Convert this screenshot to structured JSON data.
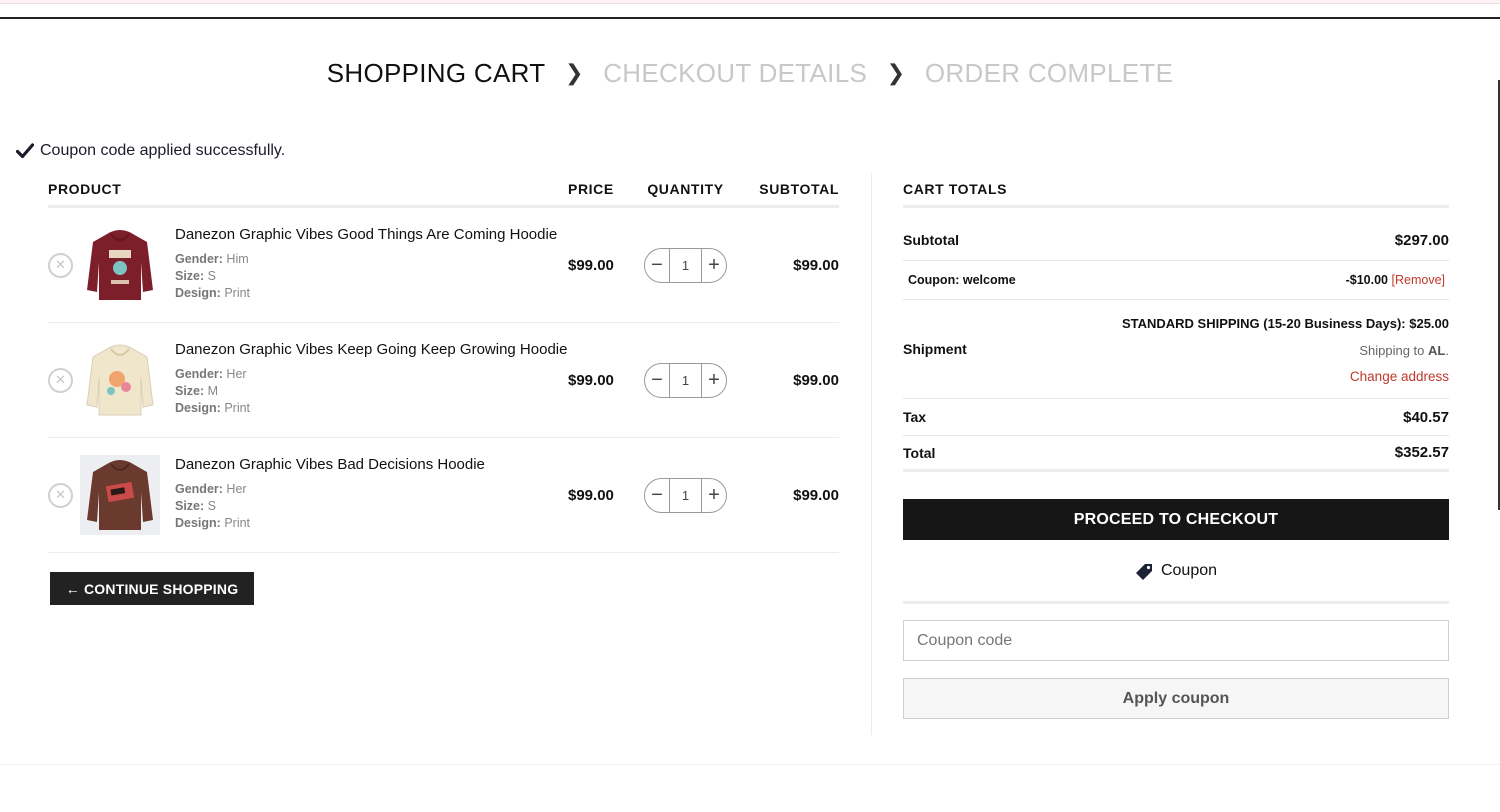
{
  "steps": {
    "cart": "SHOPPING CART",
    "checkout": "CHECKOUT DETAILS",
    "complete": "ORDER COMPLETE"
  },
  "notice": "Coupon code applied successfully.",
  "cart": {
    "headers": {
      "product": "PRODUCT",
      "price": "PRICE",
      "quantity": "QUANTITY",
      "subtotal": "SUBTOTAL"
    },
    "items": [
      {
        "name": "Danezon Graphic Vibes Good Things Are Coming Hoodie",
        "gender_label": "Gender:",
        "gender": "Him",
        "size_label": "Size:",
        "size": "S",
        "design_label": "Design:",
        "design": "Print",
        "price": "$99.00",
        "quantity": "1",
        "subtotal": "$99.00",
        "color": "#7d1f2b"
      },
      {
        "name": "Danezon Graphic Vibes Keep Going Keep Growing Hoodie",
        "gender_label": "Gender:",
        "gender": "Her",
        "size_label": "Size:",
        "size": "M",
        "design_label": "Design:",
        "design": "Print",
        "price": "$99.00",
        "quantity": "1",
        "subtotal": "$99.00",
        "color": "#efe6cc"
      },
      {
        "name": "Danezon Graphic Vibes Bad Decisions Hoodie",
        "gender_label": "Gender:",
        "gender": "Her",
        "size_label": "Size:",
        "size": "S",
        "design_label": "Design:",
        "design": "Print",
        "price": "$99.00",
        "quantity": "1",
        "subtotal": "$99.00",
        "color": "#6b3a2e"
      }
    ],
    "continue_label": "← CONTINUE SHOPPING"
  },
  "totals": {
    "title": "CART TOTALS",
    "subtotal_label": "Subtotal",
    "subtotal": "$297.00",
    "coupon_label": "Coupon: welcome",
    "coupon_value": "-$10.00",
    "coupon_remove": "[Remove]",
    "shipment_label": "Shipment",
    "shipping_method": "STANDARD SHIPPING (15-20 Business Days):",
    "shipping_cost": "$25.00",
    "shipping_to": "Shipping to",
    "shipping_dest": "AL",
    "change_address": "Change address",
    "tax_label": "Tax",
    "tax": "$40.57",
    "total_label": "Total",
    "total": "$352.57",
    "checkout_label": "PROCEED TO CHECKOUT"
  },
  "coupon": {
    "title": "Coupon",
    "placeholder": "Coupon code",
    "apply_label": "Apply coupon"
  },
  "colors": {
    "accent_red": "#c0392b",
    "button_dark": "#161616"
  }
}
